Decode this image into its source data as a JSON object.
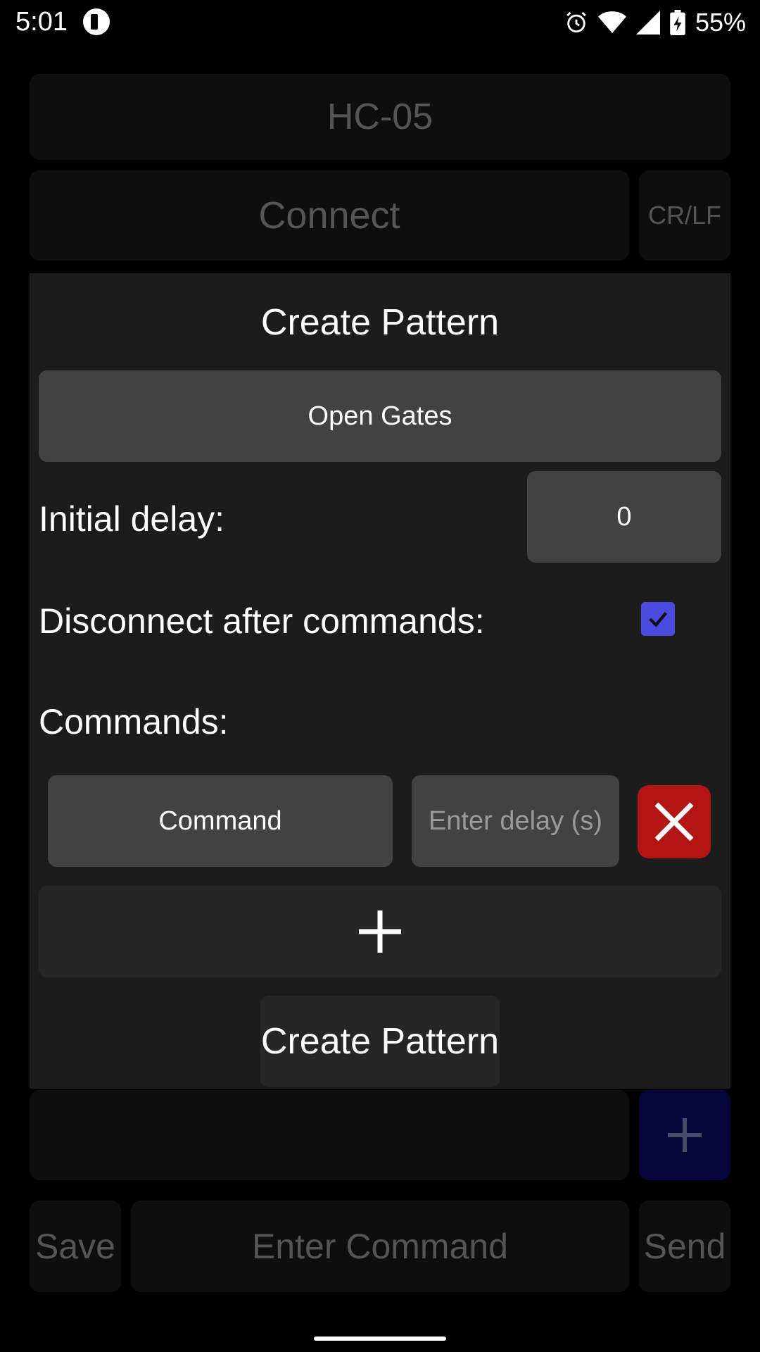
{
  "status_bar": {
    "time": "5:01",
    "battery": "55%",
    "icons": [
      "app-notification-icon",
      "alarm-icon",
      "wifi-icon",
      "signal-icon",
      "battery-charging-icon"
    ]
  },
  "background": {
    "device_name": "HC-05",
    "connect_label": "Connect",
    "line_ending_label": "CR/LF",
    "save_label": "Save",
    "command_placeholder": "Enter Command",
    "send_label": "Send",
    "add_icon": "plus-icon"
  },
  "dialog": {
    "title": "Create Pattern",
    "pattern_name_value": "Open Gates",
    "initial_delay_label": "Initial delay:",
    "initial_delay_value": "0",
    "disconnect_label": "Disconnect after commands:",
    "disconnect_checked": true,
    "commands_label": "Commands:",
    "commands": [
      {
        "command_value": "Command",
        "delay_placeholder": "Enter delay (s)"
      }
    ],
    "create_button_label": "Create Pattern"
  },
  "colors": {
    "checkbox": "#4a4adf",
    "delete": "#b31414",
    "add_button": "#06063a"
  }
}
